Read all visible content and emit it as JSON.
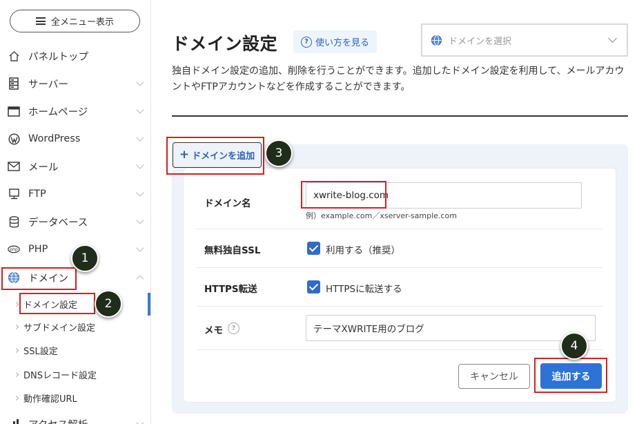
{
  "sidebar": {
    "menu_toggle_label": "全メニュー表示",
    "items": [
      {
        "label": "パネルトップ",
        "icon": "home-icon"
      },
      {
        "label": "サーバー",
        "icon": "server-icon"
      },
      {
        "label": "ホームページ",
        "icon": "browser-window-icon"
      },
      {
        "label": "WordPress",
        "icon": "wordpress-icon"
      },
      {
        "label": "メール",
        "icon": "envelope-icon"
      },
      {
        "label": "FTP",
        "icon": "monitor-icon"
      },
      {
        "label": "データベース",
        "icon": "database-icon"
      },
      {
        "label": "PHP",
        "icon": "php-icon"
      },
      {
        "label": "ドメイン",
        "icon": "globe-icon"
      }
    ],
    "sub_items": [
      {
        "label": "ドメイン設定",
        "active": true
      },
      {
        "label": "サブドメイン設定"
      },
      {
        "label": "SSL設定"
      },
      {
        "label": "DNSレコード設定"
      },
      {
        "label": "動作確認URL"
      }
    ],
    "cutoff_item_label": "アクセス解析"
  },
  "header": {
    "title": "ドメイン設定",
    "help_label": "使い方を見る",
    "domain_select_placeholder": "ドメインを選択"
  },
  "description": "独自ドメイン設定の追加、削除を行うことができます。追加したドメイン設定を利用して、メールアカウントやFTPアカウントなどを作成することができます。",
  "form": {
    "add_tab_label": "ドメインを追加",
    "domain_label": "ドメイン名",
    "domain_value": "xwrite-blog.com",
    "domain_example": "例）example.com／xserver-sample.com",
    "ssl_label": "無料独自SSL",
    "ssl_option": "利用する（推奨）",
    "ssl_checked": true,
    "https_label": "HTTPS転送",
    "https_option": "HTTPSに転送する",
    "https_checked": true,
    "memo_label": "メモ",
    "memo_value": "テーマXWRITE用のブログ",
    "cancel_label": "キャンセル",
    "submit_label": "追加する"
  },
  "annotations": {
    "step1": "1",
    "step2": "2",
    "step3": "3",
    "step4": "4",
    "highlight_color": "#d81e1e"
  },
  "colors": {
    "accent": "#2f72d6",
    "panel_bg": "#eef3fa"
  }
}
